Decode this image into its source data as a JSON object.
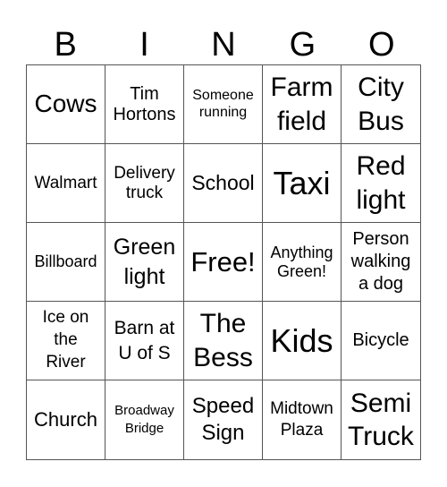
{
  "header": {
    "letters": [
      "B",
      "I",
      "N",
      "G",
      "O"
    ]
  },
  "grid": {
    "rows": [
      [
        "Cows",
        "Tim Hortons",
        "Someone running",
        "Farm field",
        "City Bus"
      ],
      [
        "Walmart",
        "Delivery truck",
        "School",
        "Taxi",
        "Red light"
      ],
      [
        "Billboard",
        "Green light",
        "Free!",
        "Anything Green!",
        "Person walking a dog"
      ],
      [
        "Ice on the River",
        "Barn at U of S",
        "The Bess",
        "Kids",
        "Bicycle"
      ],
      [
        "Church",
        "Broadway Bridge",
        "Speed Sign",
        "Midtown Plaza",
        "Semi Truck"
      ]
    ],
    "free_space": "Free!"
  }
}
